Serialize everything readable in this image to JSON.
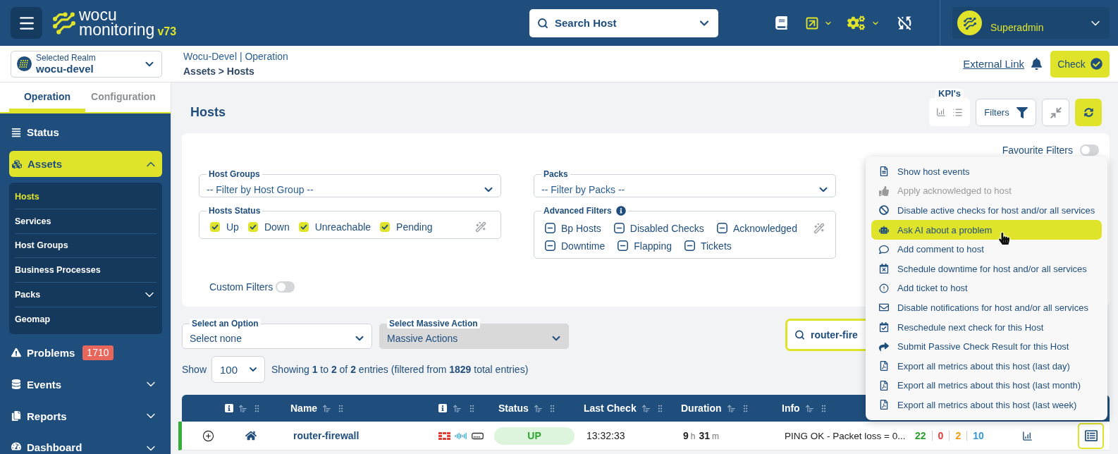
{
  "topbar": {
    "logo": {
      "line_1": "wocu",
      "line_2": "monitoring",
      "version": "v73"
    },
    "search": {
      "placeholder": "Search Host"
    },
    "user": {
      "name": "Superadmin"
    }
  },
  "subbar": {
    "realm": {
      "label": "Selected Realm",
      "value": "wocu-devel"
    },
    "breadcrumb": {
      "context": "Wocu-Devel | Operation",
      "path": "Assets > Hosts"
    },
    "external_link": "External Link",
    "check_button": "Check"
  },
  "sidebar": {
    "tabs": [
      {
        "label": "Operation",
        "selected": true
      },
      {
        "label": "Configuration",
        "selected": false
      }
    ],
    "items": [
      {
        "kind": "link",
        "label": "Status",
        "selected": false
      },
      {
        "kind": "group",
        "label": "Assets",
        "selected": true,
        "expanded": true,
        "children": [
          {
            "kind": "link",
            "label": "Hosts",
            "selected": true
          },
          {
            "kind": "link",
            "label": "Services",
            "selected": false
          },
          {
            "kind": "link",
            "label": "Host Groups",
            "selected": false
          },
          {
            "kind": "link",
            "label": "Business Processes",
            "selected": false
          },
          {
            "kind": "group",
            "label": "Packs",
            "selected": false,
            "expanded": false
          },
          {
            "kind": "link",
            "label": "Geomap",
            "selected": false
          }
        ]
      },
      {
        "kind": "link",
        "label": "Problems",
        "selected": false,
        "badge": "1710"
      },
      {
        "kind": "group",
        "label": "Events",
        "selected": false,
        "expanded": false
      },
      {
        "kind": "group",
        "label": "Reports",
        "selected": false,
        "expanded": false
      },
      {
        "kind": "group",
        "label": "Dashboard",
        "selected": false,
        "expanded": false
      }
    ]
  },
  "page": {
    "title": "Hosts",
    "kpis_label": "KPI's",
    "filters_button": "Filters"
  },
  "filters": {
    "favourite": {
      "label": "Favourite Filters",
      "on": false
    },
    "host_groups": {
      "label": "Host Groups",
      "placeholder": "-- Filter by Host Group --"
    },
    "hosts_status": {
      "label": "Hosts Status",
      "options": [
        {
          "label": "Up",
          "checked": true
        },
        {
          "label": "Down",
          "checked": true
        },
        {
          "label": "Unreachable",
          "checked": true
        },
        {
          "label": "Pending",
          "checked": true
        }
      ]
    },
    "packs": {
      "label": "Packs",
      "placeholder": "-- Filter by Packs --"
    },
    "advanced": {
      "label": "Advanced Filters",
      "options": [
        {
          "label": "Bp Hosts",
          "indeterminate": true
        },
        {
          "label": "Disabled Checks",
          "indeterminate": true
        },
        {
          "label": "Acknowledged",
          "indeterminate": true
        },
        {
          "label": "Downtime",
          "indeterminate": true
        },
        {
          "label": "Flapping",
          "indeterminate": true
        },
        {
          "label": "Tickets",
          "indeterminate": true
        }
      ]
    },
    "custom": {
      "label": "Custom Filters",
      "on": false
    }
  },
  "toolbar": {
    "select_option": {
      "label": "Select an Option",
      "value": "Select none"
    },
    "massive_action": {
      "label": "Select Massive Action",
      "value": "Massive Actions",
      "disabled": true
    },
    "search": {
      "value": "router-fire"
    }
  },
  "entries": {
    "show_label": "Show",
    "page_size": "100",
    "summary": "Showing **1** to **2** of **2** entries (filtered from **1829** total entries)"
  },
  "table": {
    "columns": [
      {
        "kind": "icon"
      },
      {
        "kind": "text",
        "label": "Name"
      },
      {
        "kind": "icon"
      },
      {
        "kind": "text",
        "label": "Status"
      },
      {
        "kind": "text",
        "label": "Last Check"
      },
      {
        "kind": "text",
        "label": "Duration"
      },
      {
        "kind": "text",
        "label": "Info"
      }
    ],
    "rows": [
      {
        "expanded": false,
        "name": "router-firewall",
        "status": {
          "kind": "up",
          "label": "UP"
        },
        "last_check": "13:32:33",
        "duration": [
          {
            "value": "9",
            "unit": "h"
          },
          {
            "value": "31",
            "unit": "m"
          }
        ],
        "info": "PING OK - Packet loss = 0...",
        "counts": [
          {
            "value": "22",
            "color": "#2ca02c"
          },
          {
            "value": "0",
            "color": "#e53935"
          },
          {
            "value": "2",
            "color": "#f39c12"
          },
          {
            "value": "10",
            "color": "#3498db"
          }
        ],
        "menu_open": true
      }
    ]
  },
  "context_menu": {
    "items": [
      {
        "label": "Show host events",
        "disabled": false,
        "selected": false
      },
      {
        "label": "Apply acknowledged to host",
        "disabled": true,
        "selected": false
      },
      {
        "label": "Disable active checks for host and/or all services",
        "disabled": false,
        "selected": false
      },
      {
        "label": "Ask AI about a problem",
        "disabled": false,
        "selected": true
      },
      {
        "label": "Add comment to host",
        "disabled": false,
        "selected": false
      },
      {
        "label": "Schedule downtime for host and/or all services",
        "disabled": false,
        "selected": false
      },
      {
        "label": "Add ticket to host",
        "disabled": false,
        "selected": false
      },
      {
        "label": "Disable notifications for host and/or all services",
        "disabled": false,
        "selected": false
      },
      {
        "label": "Reschedule next check for this Host",
        "disabled": false,
        "selected": false
      },
      {
        "label": "Submit Passive Check Result for this Host",
        "disabled": false,
        "selected": false
      },
      {
        "label": "Export all metrics about this host (last day)",
        "disabled": false,
        "selected": false
      },
      {
        "label": "Export all metrics about this host (last month)",
        "disabled": false,
        "selected": false
      },
      {
        "label": "Export all metrics about this host (last week)",
        "disabled": false,
        "selected": false
      }
    ]
  }
}
